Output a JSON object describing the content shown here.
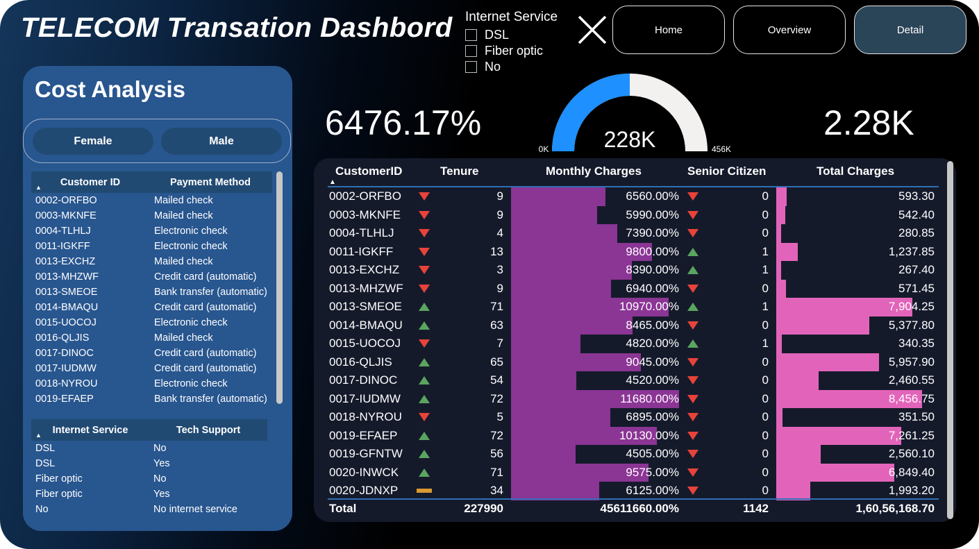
{
  "header": {
    "title": "TELECOM Transation Dashbord"
  },
  "internet_slicer": {
    "title": "Internet Service",
    "options": [
      "DSL",
      "Fiber optic",
      "No"
    ]
  },
  "nav": {
    "home": "Home",
    "overview": "Overview",
    "detail": "Detail",
    "active": "Detail"
  },
  "cost_panel": {
    "title": "Cost Analysis",
    "gender_buttons": [
      "Female",
      "Male"
    ],
    "payment_table": {
      "headers": [
        "Customer ID",
        "Payment Method"
      ],
      "rows": [
        [
          "0002-ORFBO",
          "Mailed check"
        ],
        [
          "0003-MKNFE",
          "Mailed check"
        ],
        [
          "0004-TLHLJ",
          "Electronic check"
        ],
        [
          "0011-IGKFF",
          "Electronic check"
        ],
        [
          "0013-EXCHZ",
          "Mailed check"
        ],
        [
          "0013-MHZWF",
          "Credit card (automatic)"
        ],
        [
          "0013-SMEOE",
          "Bank transfer (automatic)"
        ],
        [
          "0014-BMAQU",
          "Credit card (automatic)"
        ],
        [
          "0015-UOCOJ",
          "Electronic check"
        ],
        [
          "0016-QLJIS",
          "Mailed check"
        ],
        [
          "0017-DINOC",
          "Credit card (automatic)"
        ],
        [
          "0017-IUDMW",
          "Credit card (automatic)"
        ],
        [
          "0018-NYROU",
          "Electronic check"
        ],
        [
          "0019-EFAEP",
          "Bank transfer (automatic)"
        ]
      ]
    },
    "tech_table": {
      "headers": [
        "Internet Service",
        "Tech Support"
      ],
      "rows": [
        [
          "DSL",
          "No"
        ],
        [
          "DSL",
          "Yes"
        ],
        [
          "Fiber optic",
          "No"
        ],
        [
          "Fiber optic",
          "Yes"
        ],
        [
          "No",
          "No internet service"
        ]
      ]
    }
  },
  "kpis": {
    "left_value": "6476.17%",
    "right_value": "2.28K",
    "gauge": {
      "value_label": "228K",
      "min_label": "0K",
      "max_label": "456K",
      "value": 228,
      "min": 0,
      "max": 456,
      "fill_color": "#1e90ff",
      "track_color": "#f3f1ef"
    }
  },
  "main_table": {
    "headers": [
      "CustomerID",
      "Tenure",
      "Monthly Charges",
      "Senior Citizen",
      "Total Charges"
    ],
    "monthly_max": 11680,
    "total_max": 8456.75,
    "rows": [
      {
        "id": "0002-ORFBO",
        "t_icon": "down",
        "tenure": "9",
        "monthly": "6560.00%",
        "m": 6560,
        "s_icon": "down",
        "senior": "0",
        "total": "593.30",
        "tv": 593.3
      },
      {
        "id": "0003-MKNFE",
        "t_icon": "down",
        "tenure": "9",
        "monthly": "5990.00%",
        "m": 5990,
        "s_icon": "down",
        "senior": "0",
        "total": "542.40",
        "tv": 542.4
      },
      {
        "id": "0004-TLHLJ",
        "t_icon": "down",
        "tenure": "4",
        "monthly": "7390.00%",
        "m": 7390,
        "s_icon": "down",
        "senior": "0",
        "total": "280.85",
        "tv": 280.85
      },
      {
        "id": "0011-IGKFF",
        "t_icon": "down",
        "tenure": "13",
        "monthly": "9800.00%",
        "m": 9800,
        "s_icon": "up",
        "senior": "1",
        "total": "1,237.85",
        "tv": 1237.85
      },
      {
        "id": "0013-EXCHZ",
        "t_icon": "down",
        "tenure": "3",
        "monthly": "8390.00%",
        "m": 8390,
        "s_icon": "up",
        "senior": "1",
        "total": "267.40",
        "tv": 267.4
      },
      {
        "id": "0013-MHZWF",
        "t_icon": "down",
        "tenure": "9",
        "monthly": "6940.00%",
        "m": 6940,
        "s_icon": "down",
        "senior": "0",
        "total": "571.45",
        "tv": 571.45
      },
      {
        "id": "0013-SMEOE",
        "t_icon": "up",
        "tenure": "71",
        "monthly": "10970.00%",
        "m": 10970,
        "s_icon": "up",
        "senior": "1",
        "total": "7,904.25",
        "tv": 7904.25
      },
      {
        "id": "0014-BMAQU",
        "t_icon": "up",
        "tenure": "63",
        "monthly": "8465.00%",
        "m": 8465,
        "s_icon": "down",
        "senior": "0",
        "total": "5,377.80",
        "tv": 5377.8
      },
      {
        "id": "0015-UOCOJ",
        "t_icon": "down",
        "tenure": "7",
        "monthly": "4820.00%",
        "m": 4820,
        "s_icon": "up",
        "senior": "1",
        "total": "340.35",
        "tv": 340.35
      },
      {
        "id": "0016-QLJIS",
        "t_icon": "up",
        "tenure": "65",
        "monthly": "9045.00%",
        "m": 9045,
        "s_icon": "down",
        "senior": "0",
        "total": "5,957.90",
        "tv": 5957.9
      },
      {
        "id": "0017-DINOC",
        "t_icon": "up",
        "tenure": "54",
        "monthly": "4520.00%",
        "m": 4520,
        "s_icon": "down",
        "senior": "0",
        "total": "2,460.55",
        "tv": 2460.55
      },
      {
        "id": "0017-IUDMW",
        "t_icon": "up",
        "tenure": "72",
        "monthly": "11680.00%",
        "m": 11680,
        "s_icon": "down",
        "senior": "0",
        "total": "8,456.75",
        "tv": 8456.75
      },
      {
        "id": "0018-NYROU",
        "t_icon": "down",
        "tenure": "5",
        "monthly": "6895.00%",
        "m": 6895,
        "s_icon": "down",
        "senior": "0",
        "total": "351.50",
        "tv": 351.5
      },
      {
        "id": "0019-EFAEP",
        "t_icon": "up",
        "tenure": "72",
        "monthly": "10130.00%",
        "m": 10130,
        "s_icon": "down",
        "senior": "0",
        "total": "7,261.25",
        "tv": 7261.25
      },
      {
        "id": "0019-GFNTW",
        "t_icon": "up",
        "tenure": "56",
        "monthly": "4505.00%",
        "m": 4505,
        "s_icon": "down",
        "senior": "0",
        "total": "2,560.10",
        "tv": 2560.1
      },
      {
        "id": "0020-INWCK",
        "t_icon": "up",
        "tenure": "71",
        "monthly": "9575.00%",
        "m": 9575,
        "s_icon": "down",
        "senior": "0",
        "total": "6,849.40",
        "tv": 6849.4
      },
      {
        "id": "0020-JDNXP",
        "t_icon": "flat",
        "tenure": "34",
        "monthly": "6125.00%",
        "m": 6125,
        "s_icon": "down",
        "senior": "0",
        "total": "1,993.20",
        "tv": 1993.2
      }
    ],
    "totals": {
      "label": "Total",
      "tenure": "227990",
      "monthly": "45611660.00%",
      "senior": "1142",
      "total": "1,60,56,168.70"
    }
  },
  "colors": {
    "monthly_bar": "#8b3595",
    "total_bar": "#e264ba",
    "up_icon": "#5aa55f",
    "down_icon": "#e8433a",
    "flat_icon": "#d89a33"
  }
}
